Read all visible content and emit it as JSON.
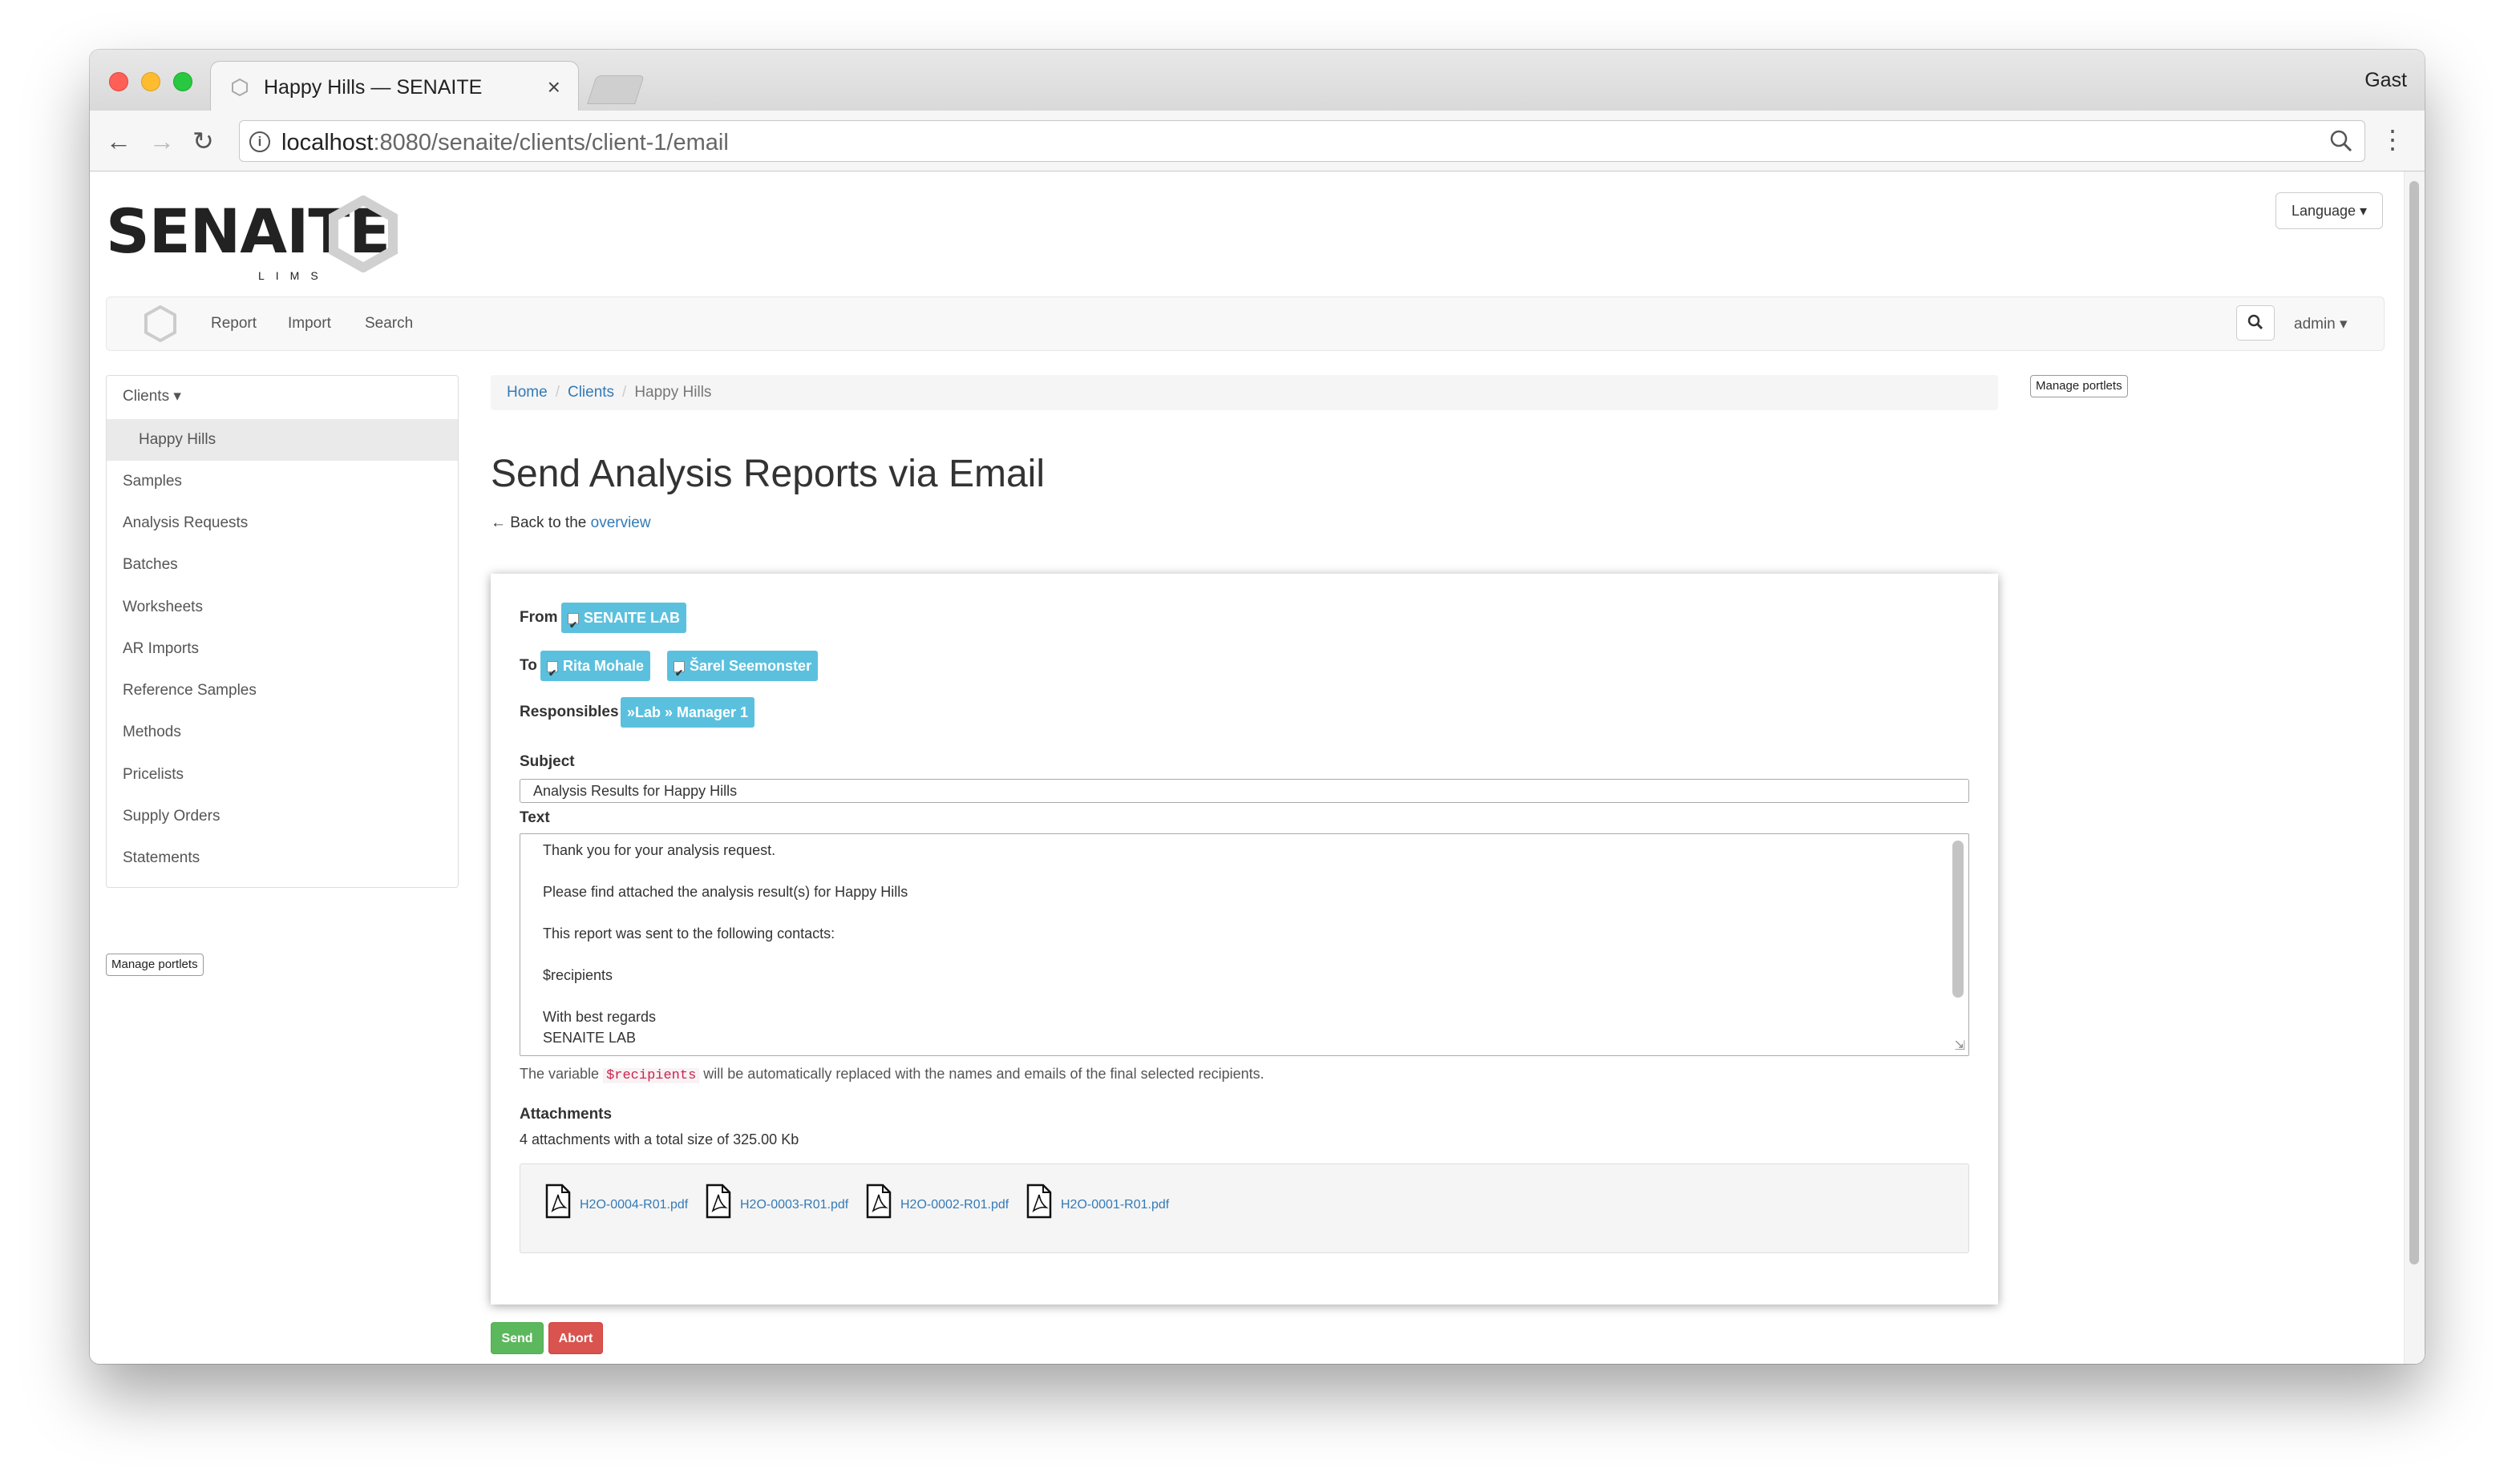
{
  "browser": {
    "tab_title": "Happy Hills — SENAITE",
    "close_glyph": "×",
    "profile_name": "Gast",
    "url_host": "localhost",
    "url_path": ":8080/senaite/clients/client-1/email"
  },
  "site": {
    "logo_text": "SENAITE",
    "logo_sub": "LIMS",
    "language_label": "Language ▾",
    "nav_items": [
      "Report",
      "Import",
      "Search"
    ],
    "user_label": "admin ▾"
  },
  "sidebar": {
    "items": [
      {
        "label": "Clients ▾"
      },
      {
        "label": "Happy Hills"
      },
      {
        "label": "Samples"
      },
      {
        "label": "Analysis Requests"
      },
      {
        "label": "Batches"
      },
      {
        "label": "Worksheets"
      },
      {
        "label": "AR Imports"
      },
      {
        "label": "Reference Samples"
      },
      {
        "label": "Methods"
      },
      {
        "label": "Pricelists"
      },
      {
        "label": "Supply Orders"
      },
      {
        "label": "Statements"
      }
    ],
    "manage_portlets": "Manage portlets"
  },
  "breadcrumb": {
    "home": "Home",
    "clients": "Clients",
    "current": "Happy Hills",
    "sep": "/"
  },
  "right_manage_portlets": "Manage portlets",
  "page": {
    "title": "Send Analysis Reports via Email",
    "back_prefix": "← Back to the ",
    "back_link": "overview"
  },
  "form": {
    "from_label": "From",
    "from_chip": "SENAITE LAB",
    "to_label": "To",
    "to_chips": [
      "Rita Mohale",
      "Šarel Seemonster"
    ],
    "responsibles_label": "Responsibles",
    "responsibles_chip": "»Lab » Manager 1",
    "subject_label": "Subject",
    "subject_value": "Analysis Results for Happy Hills",
    "text_label": "Text",
    "text_lines": [
      "Thank you for your analysis request.",
      "Please find attached the analysis result(s) for Happy Hills",
      "This report was sent to the following contacts:",
      "$recipients",
      "With best regards",
      "SENAITE LAB"
    ],
    "help_prefix": "The variable ",
    "help_code": "$recipients",
    "help_suffix": " will be automatically replaced with the names and emails of the final selected recipients.",
    "attachments_label": "Attachments",
    "attachments_summary": "4 attachments with a total size of 325.00 Kb",
    "attachments": [
      {
        "name": "H2O-0004-R01.pdf"
      },
      {
        "name": "H2O-0003-R01.pdf"
      },
      {
        "name": "H2O-0002-R01.pdf"
      },
      {
        "name": "H2O-0001-R01.pdf"
      }
    ]
  },
  "buttons": {
    "send": "Send",
    "abort": "Abort"
  },
  "colors": {
    "chip": "#5bc0de",
    "link": "#337ab7",
    "send": "#5cb85c",
    "abort": "#d9534f"
  }
}
